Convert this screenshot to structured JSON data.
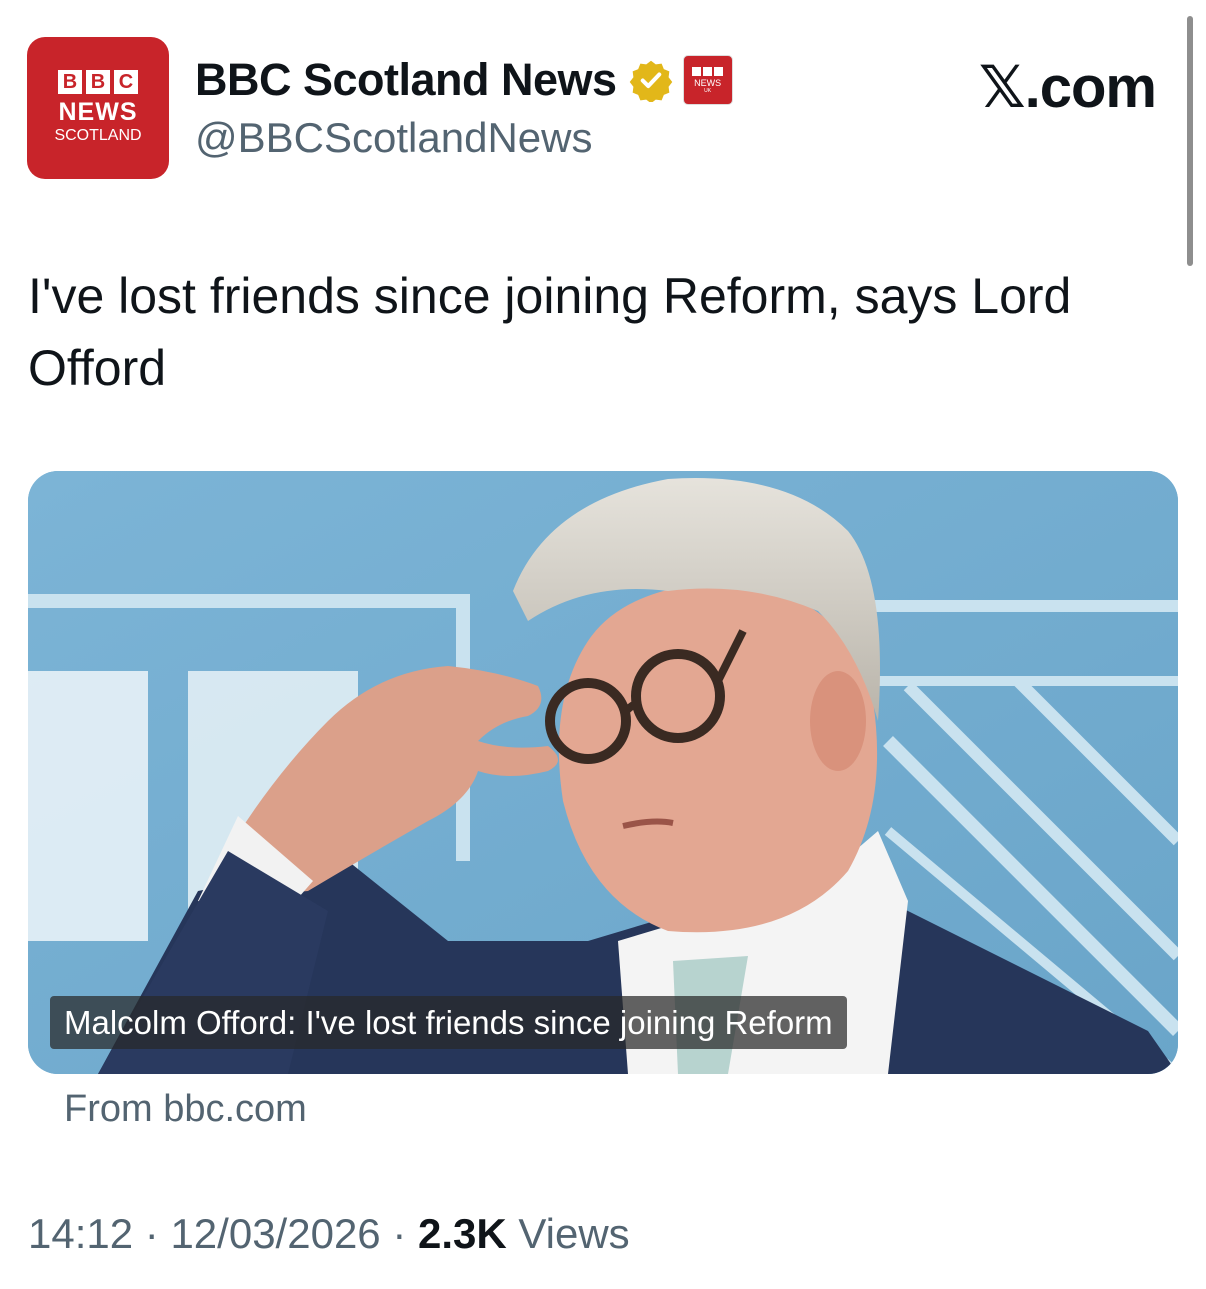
{
  "account": {
    "avatar_brand": [
      "B",
      "B",
      "C"
    ],
    "avatar_news": "NEWS",
    "avatar_region": "SCOTLAND",
    "display_name": "BBC Scotland News",
    "handle": "@BBCScotlandNews",
    "verified_icon": "gold-verified-badge-icon",
    "affiliate_badge_icon": "bbc-news-affiliate-icon",
    "affiliate_news": "NEWS",
    "affiliate_region": "UK"
  },
  "site_label": "𝕏.com",
  "tweet": {
    "text": "I've lost friends since joining Reform, says Lord Offord"
  },
  "card": {
    "caption": "Malcolm Offord: I've lost friends since joining Reform",
    "source": "From bbc.com"
  },
  "meta": {
    "time": "14:12",
    "separator": "·",
    "date": "12/03/2026",
    "views_count": "2.3K",
    "views_label": "Views"
  },
  "colors": {
    "brand_red": "#c8242a",
    "verified_gold": "#e2b719",
    "secondary_text": "#536471",
    "photo_background": "#75aed1"
  }
}
